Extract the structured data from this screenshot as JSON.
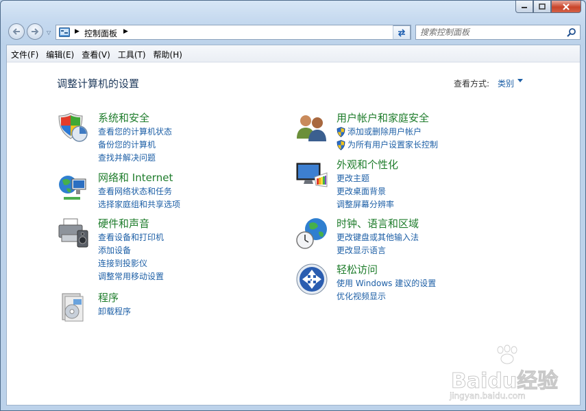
{
  "window": {
    "close_symbol": "x"
  },
  "address": {
    "crumb": "控制面板",
    "search_placeholder": "搜索控制面板"
  },
  "menu": [
    "文件(F)",
    "编辑(E)",
    "查看(V)",
    "工具(T)",
    "帮助(H)"
  ],
  "page": {
    "title": "调整计算机的设置",
    "view_by_label": "查看方式:",
    "view_by_value": "类别"
  },
  "categories": [
    {
      "title": "系统和安全",
      "icon": "shield-icon",
      "links": [
        "查看您的计算机状态",
        "备份您的计算机",
        "查找并解决问题"
      ]
    },
    {
      "title": "网络和 Internet",
      "icon": "globe-network-icon",
      "links": [
        "查看网络状态和任务",
        "选择家庭组和共享选项"
      ]
    },
    {
      "title": "硬件和声音",
      "icon": "printer-icon",
      "links": [
        "查看设备和打印机",
        "添加设备",
        "连接到投影仪",
        "调整常用移动设置"
      ]
    },
    {
      "title": "程序",
      "icon": "programs-icon",
      "links": [
        "卸载程序"
      ]
    },
    {
      "title": "用户帐户和家庭安全",
      "icon": "users-icon",
      "links": [
        "添加或删除用户帐户",
        "为所有用户设置家长控制"
      ]
    },
    {
      "title": "外观和个性化",
      "icon": "monitor-palette-icon",
      "links": [
        "更改主题",
        "更改桌面背景",
        "调整屏幕分辨率"
      ]
    },
    {
      "title": "时钟、语言和区域",
      "icon": "clock-globe-icon",
      "links": [
        "更改键盘或其他输入法",
        "更改显示语言"
      ]
    },
    {
      "title": "轻松访问",
      "icon": "ease-of-access-icon",
      "links": [
        "使用 Windows 建议的设置",
        "优化视频显示"
      ]
    }
  ],
  "watermark": {
    "text": "Baidu经验",
    "url": "jingyan.baidu.com"
  }
}
